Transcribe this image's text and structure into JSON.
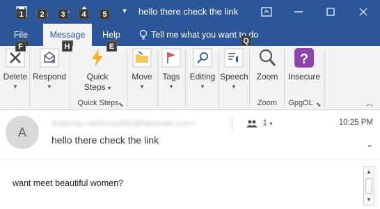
{
  "window": {
    "title": "hello there check the link",
    "buttons": [
      "restore-ribbon",
      "minimize",
      "maximize",
      "close"
    ]
  },
  "qat": {
    "keytips": [
      "1",
      "2",
      "3",
      "4",
      "5"
    ],
    "more_glyph": "▾"
  },
  "tabs": [
    {
      "label": "File",
      "keytip": "F"
    },
    {
      "label": "Message",
      "keytip": "H"
    },
    {
      "label": "Help",
      "keytip": "E"
    }
  ],
  "tellme": {
    "label": "Tell me what you want to do",
    "keytip": "Q"
  },
  "ribbon": {
    "delete": {
      "label": "Delete"
    },
    "respond": {
      "label": "Respond"
    },
    "quicksteps": {
      "label1": "Quick",
      "label2": "Steps",
      "group": "Quick Steps"
    },
    "move": {
      "label": "Move"
    },
    "tags": {
      "label": "Tags"
    },
    "editing": {
      "label": "Editing"
    },
    "speech": {
      "label": "Speech"
    },
    "zoom": {
      "label": "Zoom",
      "group": "Zoom"
    },
    "insecure": {
      "label": "Insecure",
      "group": "GpgOL"
    }
  },
  "message": {
    "avatar_initial": "A",
    "sender": "Anthony <anthony891@fakemail.com>",
    "recipients_count": "1",
    "time": "10:25 PM",
    "subject": "hello there check the link",
    "body": "want meet beautiful women?"
  },
  "colors": {
    "accent": "#2b579a",
    "ribbon_bg": "#f3f3f3",
    "insecure_icon": "#8e44ad",
    "quicksteps_icon": "#f2b022",
    "flag": "#d9534f"
  }
}
